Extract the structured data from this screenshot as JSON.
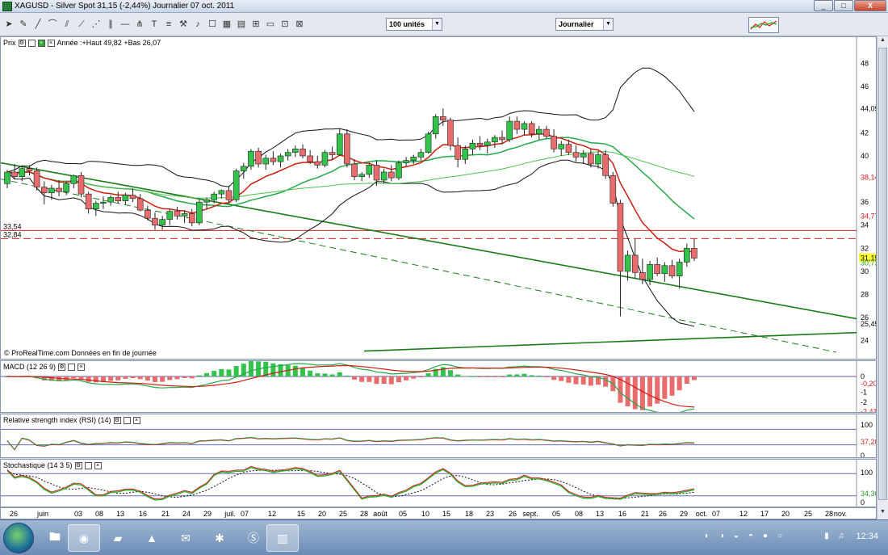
{
  "window": {
    "title": "XAGUSD - Silver Spot    31,15 (-2,44%)    Journalier  07 oct. 2011",
    "buttons": [
      "_",
      "□",
      "X"
    ]
  },
  "toolbar": {
    "units_select": "100 unités",
    "period_select": "Journalier"
  },
  "price_panel": {
    "label": "Prix",
    "annotation": "Année :+Haut 49,82 +Bas 26,07",
    "source": "© ProRealTime.com  Données en fin de journée",
    "hline_labels": [
      "33,54",
      "32,84"
    ],
    "yaxis_ticks": [
      "48",
      "46",
      "44,092",
      "42",
      "40",
      "38,142",
      "36",
      "34,773",
      "34",
      "32",
      "31,15",
      "30,72",
      "30",
      "28",
      "26",
      "25,454",
      "24"
    ],
    "colors": {
      "up": "#33c24a",
      "down": "#e86c6c",
      "ma_red": "#cc1f10",
      "ma_green": "#22a84a",
      "bollinger": "#111111",
      "trend": "#1a7a1a",
      "hline": "#d42020"
    }
  },
  "macd_panel": {
    "label": "MACD (12 26 9)",
    "yaxis_ticks": [
      "0",
      "-0,2017",
      "-1",
      "-2",
      "-2,4146"
    ]
  },
  "rsi_panel": {
    "label": "Relative strength index (RSI) (14)",
    "yaxis_ticks": [
      "100",
      "37,208",
      "0"
    ]
  },
  "sto_panel": {
    "label": "Stochastique (14 3 5)",
    "yaxis_ticks": [
      "100",
      "34,367",
      "0"
    ]
  },
  "xaxis": {
    "labels": [
      "26",
      "juin",
      "03",
      "08",
      "13",
      "16",
      "21",
      "24",
      "29",
      "juil.",
      "07",
      "12",
      "15",
      "20",
      "25",
      "28",
      "août",
      "05",
      "10",
      "15",
      "18",
      "23",
      "26",
      "sept.",
      "05",
      "08",
      "13",
      "16",
      "21",
      "26",
      "29",
      "oct.",
      "07",
      "12",
      "17",
      "20",
      "25",
      "28",
      "nov."
    ]
  },
  "chart_data": {
    "type": "candlestick",
    "title": "XAGUSD - Silver Spot",
    "ylim": [
      23,
      50
    ],
    "candles": [
      [
        37.6,
        38.8,
        37.2,
        38.6
      ],
      [
        38.6,
        39.3,
        38.0,
        38.2
      ],
      [
        38.2,
        39.0,
        37.8,
        38.9
      ],
      [
        38.9,
        39.2,
        38.3,
        38.7
      ],
      [
        38.7,
        39.0,
        37.0,
        37.3
      ],
      [
        37.3,
        37.8,
        35.8,
        36.8
      ],
      [
        36.8,
        37.5,
        36.2,
        37.2
      ],
      [
        37.2,
        37.9,
        36.5,
        36.9
      ],
      [
        36.9,
        37.8,
        36.6,
        37.6
      ],
      [
        37.6,
        38.4,
        37.2,
        38.3
      ],
      [
        38.3,
        38.6,
        36.4,
        36.7
      ],
      [
        36.7,
        36.9,
        35.0,
        35.4
      ],
      [
        35.4,
        36.1,
        34.8,
        35.9
      ],
      [
        35.9,
        36.5,
        35.4,
        36.0
      ],
      [
        36.0,
        36.6,
        35.7,
        36.4
      ],
      [
        36.4,
        36.9,
        35.9,
        36.1
      ],
      [
        36.1,
        36.8,
        35.8,
        36.6
      ],
      [
        36.6,
        37.2,
        36.0,
        36.3
      ],
      [
        36.3,
        36.7,
        35.2,
        35.3
      ],
      [
        35.3,
        35.7,
        34.4,
        34.6
      ],
      [
        34.6,
        35.1,
        33.6,
        34.0
      ],
      [
        34.0,
        34.8,
        33.6,
        34.5
      ],
      [
        34.5,
        35.4,
        34.0,
        35.2
      ],
      [
        35.2,
        35.6,
        34.5,
        34.8
      ],
      [
        34.8,
        35.3,
        34.2,
        35.0
      ],
      [
        35.0,
        35.4,
        33.9,
        34.2
      ],
      [
        34.2,
        36.2,
        34.0,
        36.0
      ],
      [
        36.0,
        36.4,
        35.4,
        36.2
      ],
      [
        36.2,
        36.9,
        35.9,
        36.7
      ],
      [
        36.7,
        37.1,
        36.3,
        37.0
      ],
      [
        37.0,
        37.4,
        35.9,
        36.2
      ],
      [
        36.2,
        38.9,
        36.0,
        38.7
      ],
      [
        38.7,
        39.4,
        38.0,
        39.1
      ],
      [
        39.1,
        40.6,
        38.8,
        40.4
      ],
      [
        40.4,
        40.7,
        39.0,
        39.3
      ],
      [
        39.3,
        40.1,
        38.8,
        39.8
      ],
      [
        39.8,
        40.4,
        39.2,
        39.5
      ],
      [
        39.5,
        40.2,
        39.0,
        40.0
      ],
      [
        40.0,
        40.6,
        39.6,
        40.3
      ],
      [
        40.3,
        40.9,
        39.9,
        40.6
      ],
      [
        40.6,
        41.0,
        39.8,
        40.0
      ],
      [
        40.0,
        40.5,
        39.3,
        39.5
      ],
      [
        39.5,
        40.0,
        38.9,
        39.2
      ],
      [
        39.2,
        40.5,
        39.0,
        40.3
      ],
      [
        40.3,
        40.8,
        39.7,
        40.1
      ],
      [
        40.1,
        42.4,
        40.0,
        41.9
      ],
      [
        41.9,
        42.3,
        39.0,
        39.3
      ],
      [
        39.3,
        39.7,
        37.9,
        38.2
      ],
      [
        38.2,
        38.6,
        37.8,
        38.4
      ],
      [
        38.4,
        39.4,
        38.1,
        39.2
      ],
      [
        39.2,
        39.6,
        37.4,
        37.9
      ],
      [
        37.9,
        38.9,
        37.6,
        38.6
      ],
      [
        38.6,
        39.2,
        37.8,
        38.1
      ],
      [
        38.1,
        39.6,
        37.9,
        39.4
      ],
      [
        39.4,
        39.9,
        39.1,
        39.6
      ],
      [
        39.6,
        40.1,
        39.3,
        39.9
      ],
      [
        39.9,
        40.6,
        39.6,
        40.3
      ],
      [
        40.3,
        42.1,
        40.2,
        41.9
      ],
      [
        41.9,
        43.6,
        41.5,
        43.4
      ],
      [
        43.4,
        44.1,
        42.6,
        43.1
      ],
      [
        43.1,
        43.3,
        40.5,
        40.9
      ],
      [
        40.9,
        41.6,
        39.0,
        39.7
      ],
      [
        39.7,
        40.9,
        39.3,
        40.6
      ],
      [
        40.6,
        41.4,
        40.1,
        41.1
      ],
      [
        41.1,
        41.7,
        40.5,
        40.9
      ],
      [
        40.9,
        41.5,
        40.2,
        41.2
      ],
      [
        41.2,
        41.8,
        40.7,
        41.6
      ],
      [
        41.6,
        42.2,
        41.0,
        41.4
      ],
      [
        41.4,
        43.4,
        41.2,
        43.0
      ],
      [
        43.0,
        43.4,
        41.9,
        42.3
      ],
      [
        42.3,
        43.0,
        41.8,
        42.8
      ],
      [
        42.8,
        43.0,
        41.6,
        41.9
      ],
      [
        41.9,
        42.6,
        41.4,
        42.3
      ],
      [
        42.3,
        42.6,
        41.5,
        41.7
      ],
      [
        41.7,
        42.3,
        40.3,
        40.6
      ],
      [
        40.6,
        41.3,
        40.0,
        41.0
      ],
      [
        41.0,
        41.4,
        40.1,
        40.3
      ],
      [
        40.3,
        40.9,
        39.5,
        39.9
      ],
      [
        39.9,
        40.5,
        39.3,
        40.2
      ],
      [
        40.2,
        40.6,
        39.0,
        39.3
      ],
      [
        39.3,
        40.4,
        38.9,
        40.1
      ],
      [
        40.1,
        40.5,
        38.0,
        38.3
      ],
      [
        38.3,
        38.6,
        35.6,
        35.9
      ],
      [
        35.9,
        36.2,
        26.1,
        30.0
      ],
      [
        30.0,
        31.8,
        29.2,
        31.4
      ],
      [
        31.4,
        32.8,
        29.4,
        29.9
      ],
      [
        29.9,
        31.1,
        28.9,
        29.3
      ],
      [
        29.3,
        30.9,
        28.8,
        30.6
      ],
      [
        30.6,
        31.2,
        29.6,
        29.8
      ],
      [
        29.8,
        30.8,
        29.1,
        30.5
      ],
      [
        30.5,
        31.0,
        29.4,
        29.6
      ],
      [
        29.6,
        31.1,
        28.5,
        30.8
      ],
      [
        30.8,
        32.4,
        30.4,
        32.0
      ],
      [
        32.0,
        32.8,
        30.9,
        31.15
      ]
    ]
  }
}
